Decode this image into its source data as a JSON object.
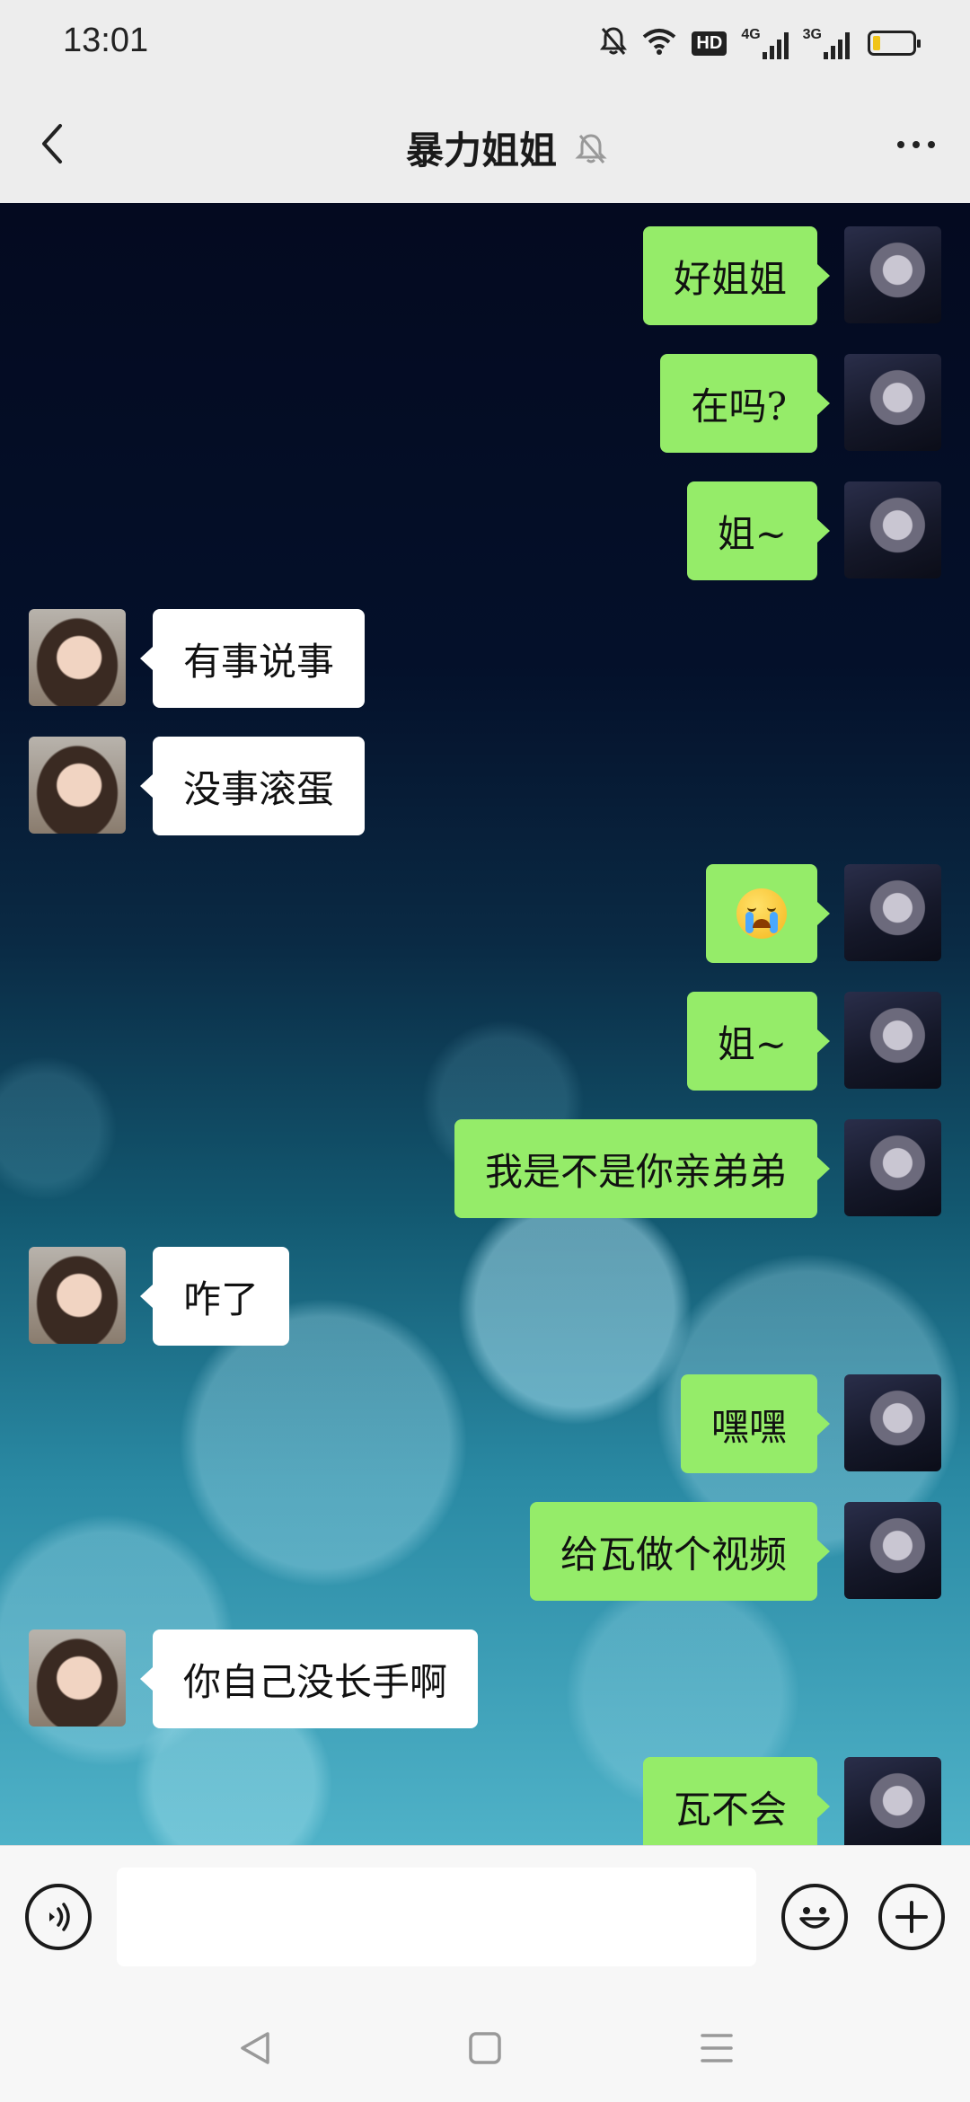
{
  "status_bar": {
    "time": "13:01",
    "hd_label": "HD",
    "network_1": "4G",
    "network_2": "3G",
    "battery_level": 0.18,
    "battery_color": "#f0c419"
  },
  "header": {
    "title": "暴力姐姐",
    "back_icon": "chevron-left-icon",
    "mute_icon": "bell-off-icon",
    "more_icon": "more-horizontal-icon"
  },
  "messages": [
    {
      "side": "out",
      "text": "好姐姐"
    },
    {
      "side": "out",
      "text": "在吗?"
    },
    {
      "side": "out",
      "text": "姐~"
    },
    {
      "side": "in",
      "text": "有事说事"
    },
    {
      "side": "in",
      "text": "没事滚蛋"
    },
    {
      "side": "out",
      "emoji": "crying-face-emoji"
    },
    {
      "side": "out",
      "text": "姐~"
    },
    {
      "side": "out",
      "text": "我是不是你亲弟弟"
    },
    {
      "side": "in",
      "text": "咋了"
    },
    {
      "side": "out",
      "text": "嘿嘿"
    },
    {
      "side": "out",
      "text": "给瓦做个视频"
    },
    {
      "side": "in",
      "text": "你自己没长手啊"
    },
    {
      "side": "out",
      "text": "瓦不会"
    }
  ],
  "input_bar": {
    "voice_icon": "voice-icon",
    "emoji_icon": "emoji-icon",
    "plus_icon": "plus-icon",
    "message_value": ""
  },
  "nav_bar": {
    "back_icon": "nav-back-icon",
    "home_icon": "nav-home-icon",
    "menu_icon": "nav-menu-icon"
  },
  "colors": {
    "outgoing_bubble": "#95ec69",
    "incoming_bubble": "#ffffff",
    "header_bg": "#ededed"
  }
}
